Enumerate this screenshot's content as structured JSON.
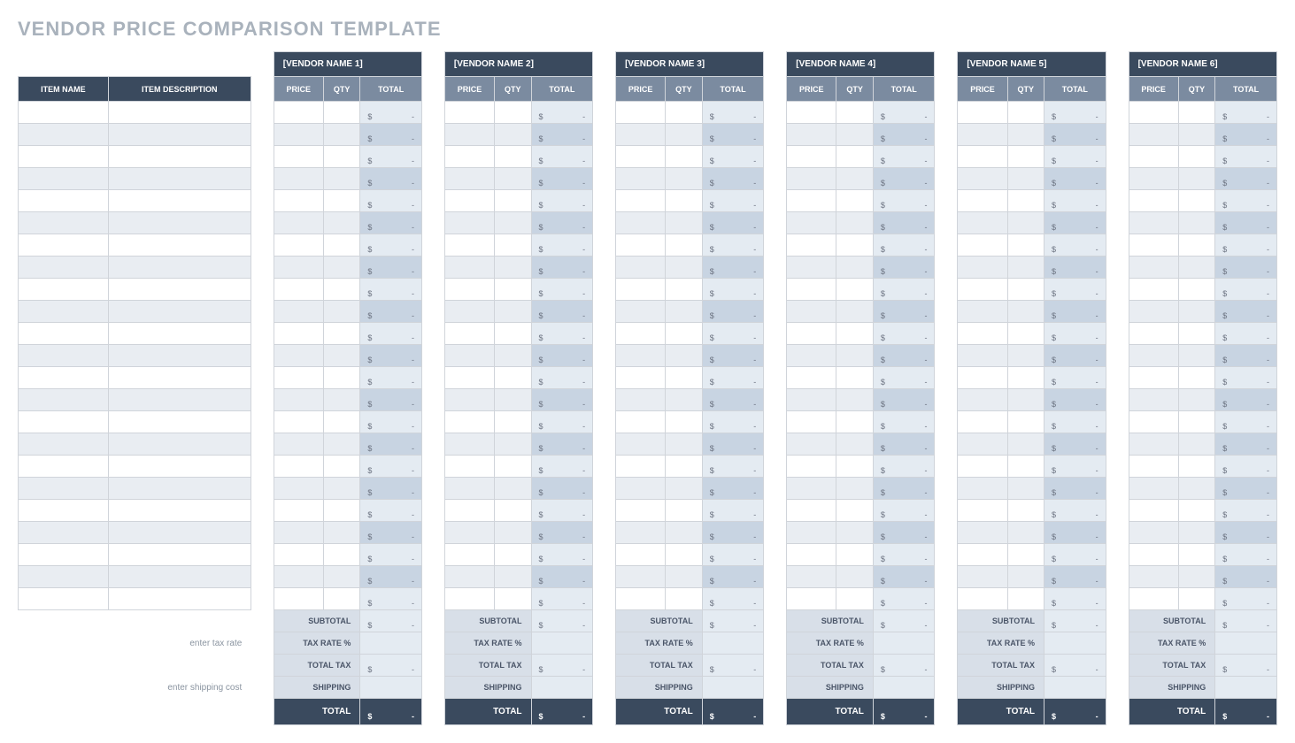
{
  "title": "VENDOR PRICE COMPARISON TEMPLATE",
  "headers": {
    "item_name": "ITEM NAME",
    "item_description": "ITEM DESCRIPTION",
    "price": "PRICE",
    "qty": "QTY",
    "total": "TOTAL"
  },
  "vendors": [
    "[VENDOR NAME 1]",
    "[VENDOR NAME 2]",
    "[VENDOR NAME 3]",
    "[VENDOR NAME 4]",
    "[VENDOR NAME 5]",
    "[VENDOR NAME 6]"
  ],
  "row_count": 23,
  "currency_symbol": "$",
  "empty_value": "-",
  "summary": {
    "subtotal": "SUBTOTAL",
    "tax_rate": "TAX RATE %",
    "total_tax": "TOTAL TAX",
    "shipping": "SHIPPING",
    "total": "TOTAL"
  },
  "hints": {
    "tax": "enter tax rate",
    "shipping": "enter shipping cost"
  }
}
